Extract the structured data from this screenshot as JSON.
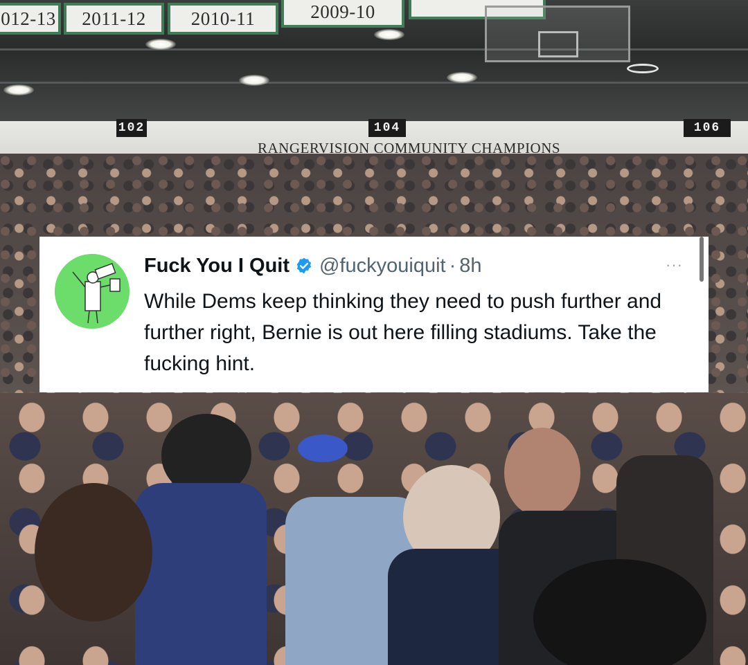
{
  "background": {
    "banners": [
      "012-13",
      "2011-12",
      "2010-11",
      "2009-10",
      ""
    ],
    "sections": [
      "102",
      "104",
      "106"
    ],
    "wall_sign": "RANGERVISION COMMUNITY CHAMPIONS"
  },
  "tweet": {
    "display_name": "Fuck You I Quit",
    "handle": "@fuckyouiquit",
    "separator": "·",
    "time": "8h",
    "more_label": "···",
    "text": "While Dems keep thinking they need to push further and further right, Bernie is out here filling stadiums. Take the fucking hint.",
    "avatar_icon": "cartoon-figure-icon",
    "verified_icon": "verified-badge-icon",
    "colors": {
      "avatar_bg": "#6cdc6a",
      "verified": "#1d9bf0",
      "handle": "#536471",
      "text": "#0f1419"
    }
  }
}
